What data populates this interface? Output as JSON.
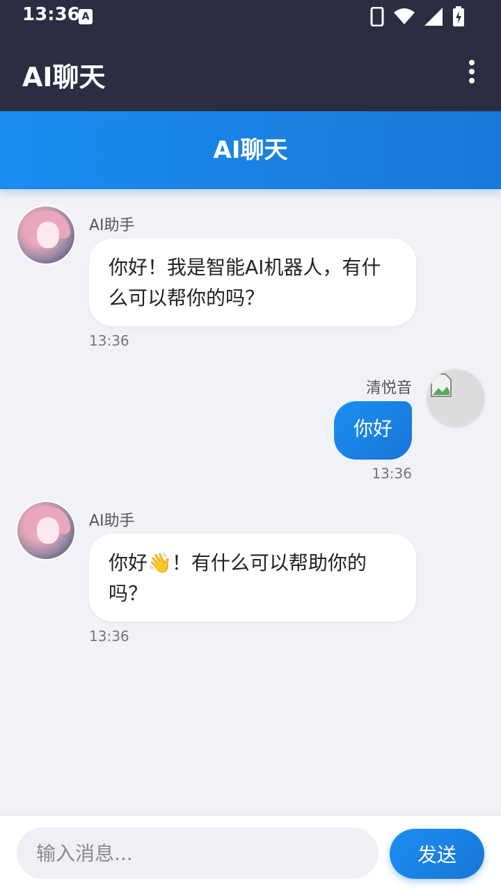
{
  "status_bar": {
    "time": "13:36",
    "a_icon": "A"
  },
  "app_bar": {
    "title": "AI聊天",
    "menu_icon": "more-vert-icon"
  },
  "chat_header": {
    "title": "AI聊天"
  },
  "messages": [
    {
      "sender": "AI助手",
      "text": "你好！我是智能AI机器人，有什么可以帮你的吗？",
      "time": "13:36",
      "role": "ai"
    },
    {
      "sender": "清悦音",
      "text": "你好",
      "time": "13:36",
      "role": "user"
    },
    {
      "sender": "AI助手",
      "text": "你好👋！有什么可以帮助你的吗？",
      "time": "13:36",
      "role": "ai"
    }
  ],
  "composer": {
    "placeholder": "输入消息...",
    "send_label": "发送"
  },
  "colors": {
    "bar_bg": "#2b2d42",
    "accent": "#1a8cf0",
    "chat_bg": "#f0f2f7"
  }
}
